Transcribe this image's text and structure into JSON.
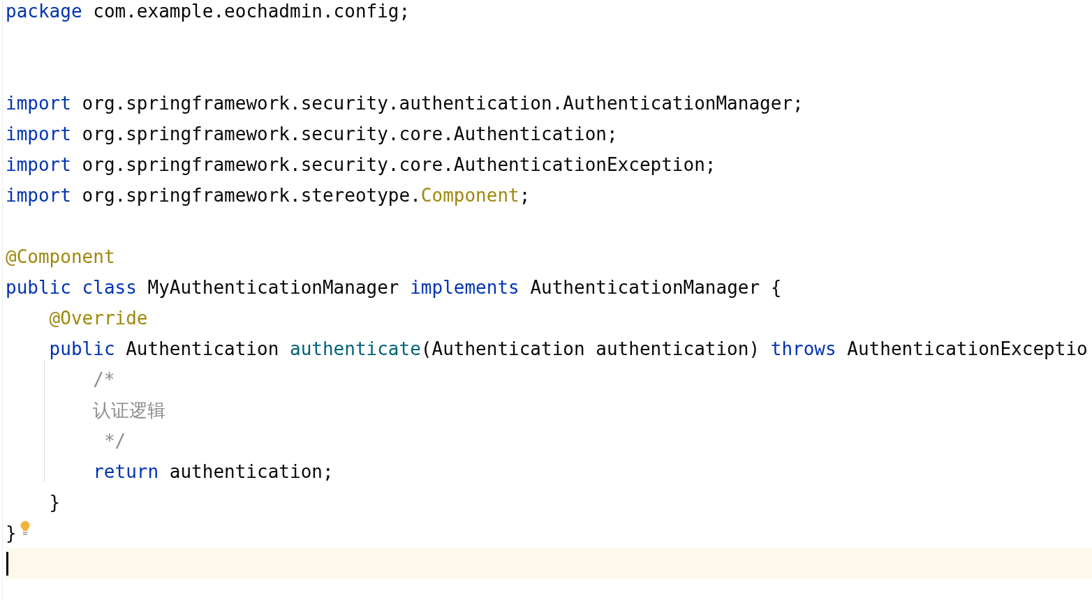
{
  "editor": {
    "lines": [
      {
        "kind": "code",
        "tokens": [
          {
            "kind": "keyword",
            "text": "package"
          },
          {
            "kind": "plain",
            "text": " com.example.eochadmin.config;"
          }
        ]
      },
      {
        "kind": "blank"
      },
      {
        "kind": "blank"
      },
      {
        "kind": "code",
        "tokens": [
          {
            "kind": "keyword",
            "text": "import"
          },
          {
            "kind": "plain",
            "text": " org.springframework.security.authentication.AuthenticationManager;"
          }
        ]
      },
      {
        "kind": "code",
        "tokens": [
          {
            "kind": "keyword",
            "text": "import"
          },
          {
            "kind": "plain",
            "text": " org.springframework.security.core.Authentication;"
          }
        ]
      },
      {
        "kind": "code",
        "tokens": [
          {
            "kind": "keyword",
            "text": "import"
          },
          {
            "kind": "plain",
            "text": " org.springframework.security.core.AuthenticationException;"
          }
        ]
      },
      {
        "kind": "code",
        "tokens": [
          {
            "kind": "keyword",
            "text": "import"
          },
          {
            "kind": "plain",
            "text": " org.springframework.stereotype."
          },
          {
            "kind": "annotation",
            "text": "Component"
          },
          {
            "kind": "plain",
            "text": ";"
          }
        ]
      },
      {
        "kind": "blank"
      },
      {
        "kind": "code",
        "tokens": [
          {
            "kind": "annotation",
            "text": "@Component"
          }
        ]
      },
      {
        "kind": "code",
        "tokens": [
          {
            "kind": "keyword",
            "text": "public class"
          },
          {
            "kind": "plain",
            "text": " MyAuthenticationManager "
          },
          {
            "kind": "keyword",
            "text": "implements"
          },
          {
            "kind": "plain",
            "text": " AuthenticationManager {"
          }
        ]
      },
      {
        "kind": "code",
        "tokens": [
          {
            "kind": "annotation",
            "text": "    @Override"
          }
        ]
      },
      {
        "kind": "code",
        "tokens": [
          {
            "kind": "keyword",
            "text": "    public"
          },
          {
            "kind": "plain",
            "text": " Authentication "
          },
          {
            "kind": "method",
            "text": "authenticate"
          },
          {
            "kind": "plain",
            "text": "(Authentication authentication) "
          },
          {
            "kind": "keyword",
            "text": "throws"
          },
          {
            "kind": "plain",
            "text": " AuthenticationExceptio"
          }
        ]
      },
      {
        "kind": "code",
        "tokens": [
          {
            "kind": "comment",
            "text": "        /*"
          }
        ]
      },
      {
        "kind": "code",
        "tokens": [
          {
            "kind": "comment",
            "text": "        认证逻辑"
          }
        ]
      },
      {
        "kind": "code",
        "tokens": [
          {
            "kind": "comment",
            "text": "         */"
          }
        ]
      },
      {
        "kind": "code",
        "tokens": [
          {
            "kind": "keyword",
            "text": "        return"
          },
          {
            "kind": "plain",
            "text": " authentication;"
          }
        ]
      },
      {
        "kind": "code",
        "tokens": [
          {
            "kind": "plain",
            "text": "    }"
          }
        ]
      },
      {
        "kind": "code",
        "bulb": true,
        "tokens": [
          {
            "kind": "plain",
            "text": "}"
          }
        ]
      },
      {
        "kind": "cursor"
      }
    ]
  }
}
